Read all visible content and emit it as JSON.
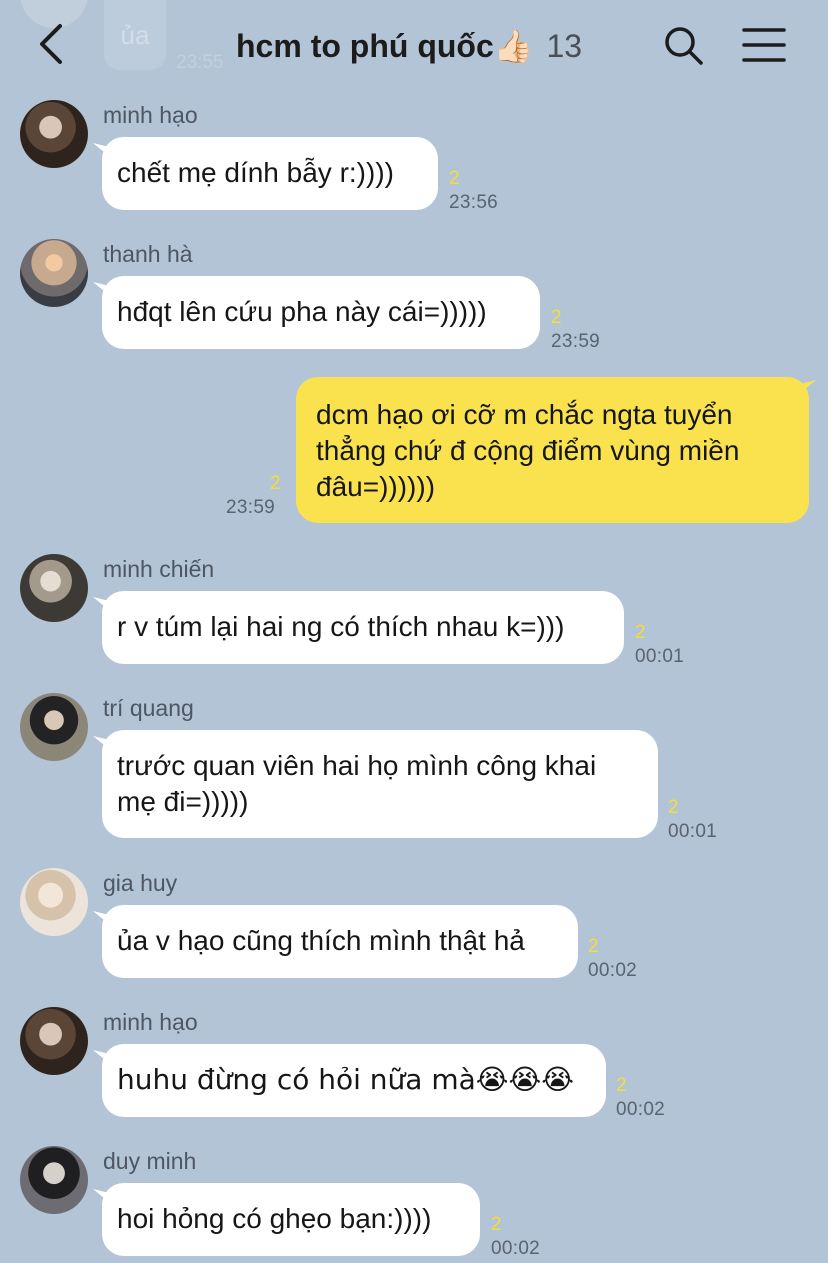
{
  "header": {
    "title": "hcm to phú quốc",
    "title_emoji": "👍🏻",
    "member_count": "13",
    "prev_message_text": "ủa",
    "prev_message_time": "23:55"
  },
  "colors": {
    "background": "#b2c4d6",
    "incoming_bubble": "#ffffff",
    "outgoing_bubble": "#f9e24e",
    "unread_count": "#f5dd3a"
  },
  "messages": [
    {
      "sender": "minh hạo",
      "text": "chết mẹ dính bẫy r:))))",
      "unread": "2",
      "time": "23:56",
      "outgoing": false
    },
    {
      "sender": "thanh hà",
      "text": "hđqt lên cứu pha này cái=)))))",
      "unread": "2",
      "time": "23:59",
      "outgoing": false
    },
    {
      "sender": "",
      "text": "dcm hạo ơi cỡ m chắc ngta tuyển thẳng chứ đ cộng điểm vùng miền đâu=))))))",
      "unread": "2",
      "time": "23:59",
      "outgoing": true
    },
    {
      "sender": "minh chiến",
      "text": "r v túm lại hai ng có thích nhau k=)))",
      "unread": "2",
      "time": "00:01",
      "outgoing": false
    },
    {
      "sender": "trí quang",
      "text": "trước quan viên hai họ mình công khai mẹ đi=)))))",
      "unread": "2",
      "time": "00:01",
      "outgoing": false
    },
    {
      "sender": "gia huy",
      "text": "ủa v hạo cũng thích mình thật hả",
      "unread": "2",
      "time": "00:02",
      "outgoing": false
    },
    {
      "sender": "minh hạo",
      "text": "huhu đừng có hỏi nữa mà😭😭😭",
      "unread": "2",
      "time": "00:02",
      "outgoing": false
    },
    {
      "sender": "duy minh",
      "text": "hoi hỏng có ghẹo bạn:))))",
      "unread": "2",
      "time": "00:02",
      "outgoing": false
    }
  ],
  "icons": {
    "back": "chevron-left-icon",
    "search": "search-icon",
    "menu": "menu-icon"
  }
}
